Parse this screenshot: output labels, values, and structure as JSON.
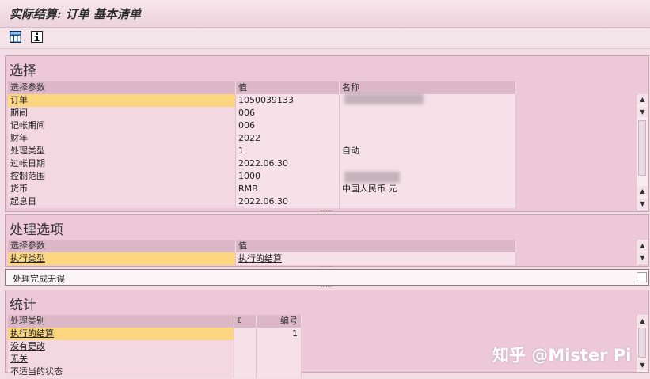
{
  "window": {
    "title": "实际结算: 订单 基本清单"
  },
  "toolbar": {
    "icons": [
      "layout-icon",
      "info-icon"
    ]
  },
  "selection": {
    "title": "选择",
    "headers": [
      "选择参数",
      "值",
      "名称"
    ],
    "rows": [
      {
        "param": "订单",
        "value": "1050039133",
        "name": ""
      },
      {
        "param": "期间",
        "value": "006",
        "name": ""
      },
      {
        "param": "记帐期间",
        "value": "006",
        "name": ""
      },
      {
        "param": "财年",
        "value": "2022",
        "name": ""
      },
      {
        "param": "处理类型",
        "value": "1",
        "name": "自动"
      },
      {
        "param": "过帐日期",
        "value": "2022.06.30",
        "name": ""
      },
      {
        "param": "控制范围",
        "value": "1000",
        "name": ""
      },
      {
        "param": "货币",
        "value": "RMB",
        "name": "中国人民币 元"
      },
      {
        "param": "起息日",
        "value": "2022.06.30",
        "name": ""
      }
    ]
  },
  "options": {
    "title": "处理选项",
    "headers": [
      "选择参数",
      "值"
    ],
    "rows": [
      {
        "param": "执行类型",
        "value": "执行的结算"
      }
    ]
  },
  "message": {
    "text": "处理完成无误"
  },
  "statistics": {
    "title": "统计",
    "headers": [
      "处理类别",
      "Σ",
      "编号"
    ],
    "rows": [
      {
        "category": "执行的结算",
        "count": "1"
      },
      {
        "category": "没有更改",
        "count": ""
      },
      {
        "category": "无关",
        "count": ""
      },
      {
        "category": "不适当的状态",
        "count": ""
      }
    ]
  },
  "watermark": "知乎 @Mister Pi",
  "colors": {
    "selected_cell": "#fbd67f",
    "section_bg": "#edc8d6",
    "header_bg": "#dcb8c6"
  }
}
